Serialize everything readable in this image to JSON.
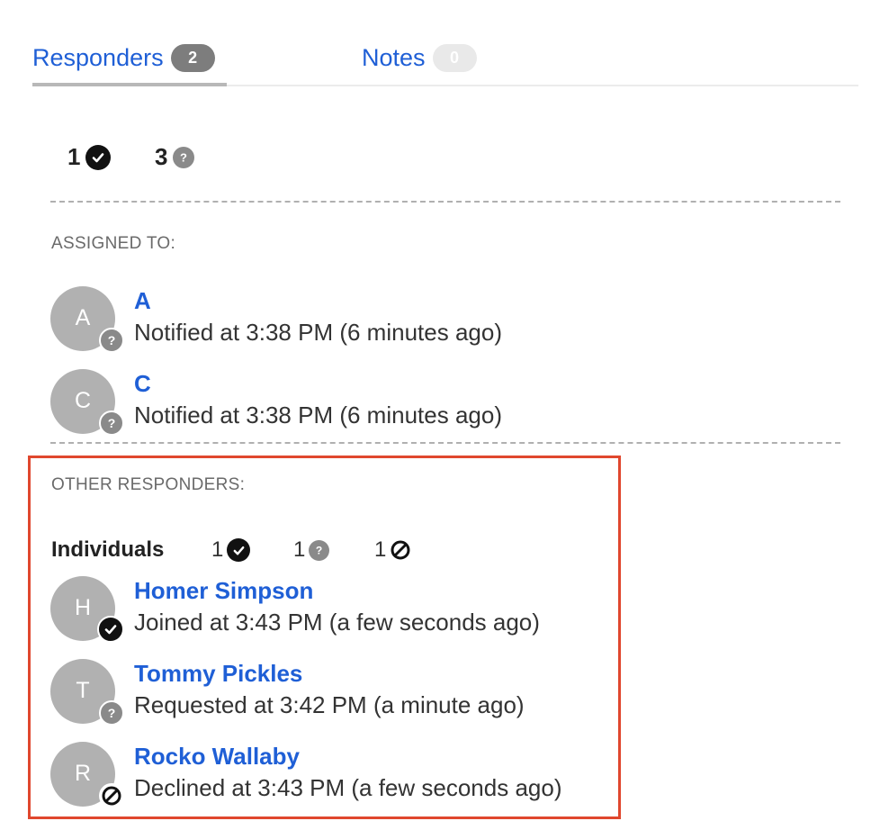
{
  "tabs": [
    {
      "label": "Responders",
      "count": "2"
    },
    {
      "label": "Notes",
      "count": "0"
    }
  ],
  "summary": {
    "acknowledged_count": "1",
    "pending_count": "3"
  },
  "assigned": {
    "label": "ASSIGNED TO:",
    "people": [
      {
        "initial": "A",
        "name": "A",
        "status": "Notified at 3:38 PM (6 minutes ago)",
        "icon": "question-icon"
      },
      {
        "initial": "C",
        "name": "C",
        "status": "Notified at 3:38 PM (6 minutes ago)",
        "icon": "question-icon"
      }
    ]
  },
  "other": {
    "label": "OTHER RESPONDERS:",
    "individuals_label": "Individuals",
    "counts": {
      "joined": "1",
      "requested": "1",
      "declined": "1"
    },
    "people": [
      {
        "initial": "H",
        "name": "Homer Simpson",
        "status": "Joined at 3:43 PM (a few seconds ago)",
        "icon": "check-icon"
      },
      {
        "initial": "T",
        "name": "Tommy Pickles",
        "status": "Requested at 3:42 PM (a minute ago)",
        "icon": "question-icon"
      },
      {
        "initial": "R",
        "name": "Rocko Wallaby",
        "status": "Declined at 3:43 PM (a few seconds ago)",
        "icon": "declined-icon"
      }
    ]
  },
  "colors": {
    "link": "#1f5fd6",
    "highlight_border": "#e0472e",
    "avatar": "#b1b1b1"
  }
}
